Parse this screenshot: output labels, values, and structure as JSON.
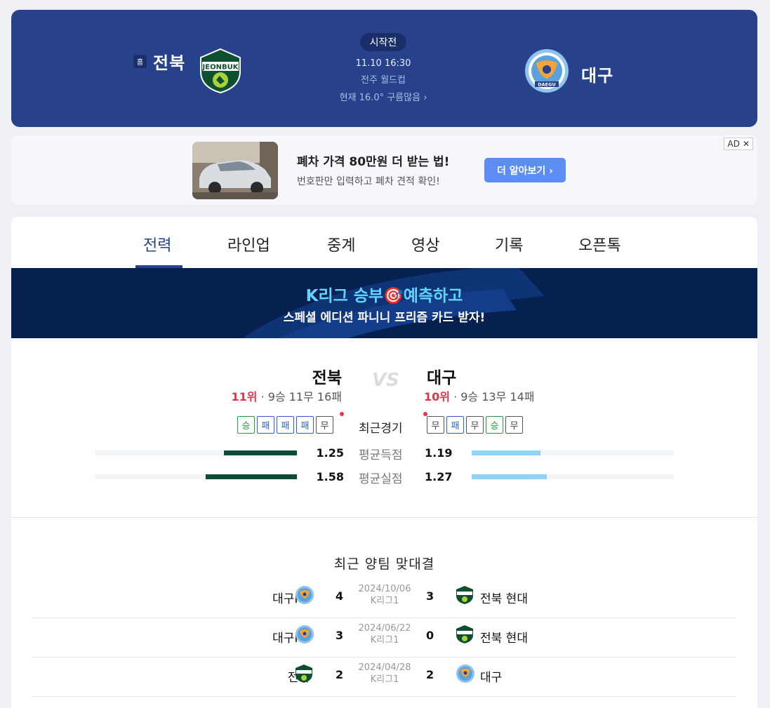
{
  "header": {
    "home_badge": "홈",
    "home_team": "전북",
    "away_team": "대구",
    "status": "시작전",
    "kickoff": "11.10 16:30",
    "venue": "전주 월드컵",
    "weather": "현재 16.0° 구름많음 ›",
    "home_logo_text": "JEONBUK",
    "away_logo_text": "DAEGU"
  },
  "ad": {
    "title": "폐차 가격 80만원 더 받는 법!",
    "description": "번호판만 입력하고 폐차 견적 확인!",
    "button": "더 알아보기 ›",
    "label": "AD",
    "close": "✕"
  },
  "tabs": [
    {
      "label": "전력",
      "active": true
    },
    {
      "label": "라인업",
      "active": false
    },
    {
      "label": "중계",
      "active": false
    },
    {
      "label": "영상",
      "active": false
    },
    {
      "label": "기록",
      "active": false
    },
    {
      "label": "오픈톡",
      "active": false
    }
  ],
  "banner": {
    "line1": "K리그 승부🎯예측하고",
    "line2": "스페셜 에디션 파니니 프리즘 카드 받자!"
  },
  "comparison": {
    "home_name": "전북",
    "away_name": "대구",
    "vs": "VS",
    "home_rank": "11위",
    "home_record": "· 9승 11무 16패",
    "away_rank": "10위",
    "away_record": "· 9승 13무 14패",
    "recent_label": "최근경기",
    "home_form": [
      "승",
      "패",
      "패",
      "패",
      "무"
    ],
    "away_form": [
      "무",
      "패",
      "무",
      "승",
      "무"
    ],
    "stats": [
      {
        "label": "평균득점",
        "home": "1.25",
        "away": "1.19",
        "home_fill": 0.36,
        "away_fill": 0.34
      },
      {
        "label": "평균실점",
        "home": "1.58",
        "away": "1.27",
        "home_fill": 0.45,
        "away_fill": 0.37
      }
    ]
  },
  "h2h": {
    "title": "최근 양팀 맞대결",
    "matches": [
      {
        "home": "대구FC",
        "home_team": "daegu",
        "home_score": "4",
        "date": "2024/10/06",
        "league": "K리그1",
        "away_score": "3",
        "away": "전북 현대",
        "away_team": "jeonbuk"
      },
      {
        "home": "대구FC",
        "home_team": "daegu",
        "home_score": "3",
        "date": "2024/06/22",
        "league": "K리그1",
        "away_score": "0",
        "away": "전북 현대",
        "away_team": "jeonbuk"
      },
      {
        "home": "전북",
        "home_team": "jeonbuk",
        "home_score": "2",
        "date": "2024/04/28",
        "league": "K리그1",
        "away_score": "2",
        "away": "대구",
        "away_team": "daegu"
      }
    ]
  },
  "colors": {
    "header_bg": "#27428a",
    "rank_red": "#e5334b",
    "win_green": "#20a13a",
    "loss_blue": "#2b62c8",
    "home_bar": "#0c4a3a",
    "away_bar": "#8ed4fa"
  }
}
